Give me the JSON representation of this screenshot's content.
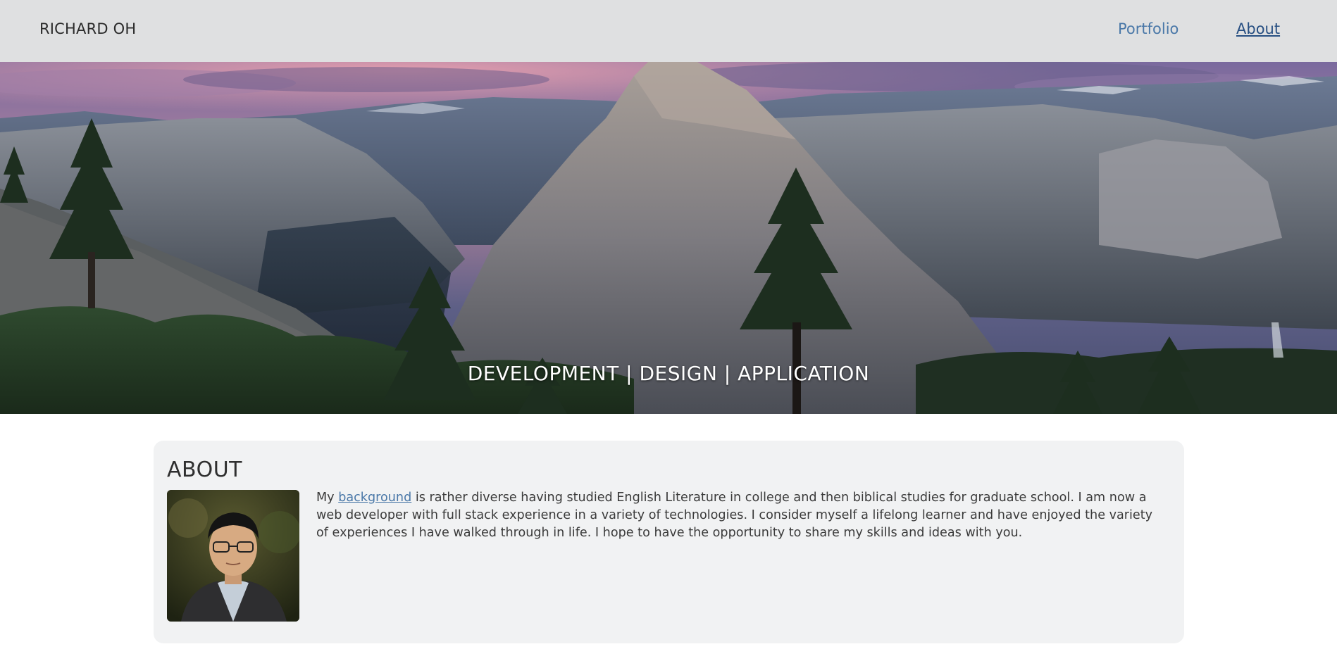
{
  "nav": {
    "brand": "RICHARD OH",
    "links": [
      {
        "label": "Portfolio"
      },
      {
        "label": "About"
      }
    ]
  },
  "hero": {
    "tagline": "DEVELOPMENT | DESIGN | APPLICATION"
  },
  "about": {
    "title": "ABOUT",
    "text_before": "My ",
    "link_label": "background",
    "text_after": " is rather diverse having studied English Literature in college and then biblical studies for graduate school. I am now a web developer with full stack experience in a variety of technologies. I consider myself a lifelong learner and have enjoyed the variety of experiences I have walked through in life. I hope to have the opportunity to share my skills and ideas with you."
  },
  "colors": {
    "navbar_bg": "#dfe0e1",
    "link": "#4a78a8",
    "link_active": "#274f82",
    "card_bg": "#f1f2f3"
  }
}
